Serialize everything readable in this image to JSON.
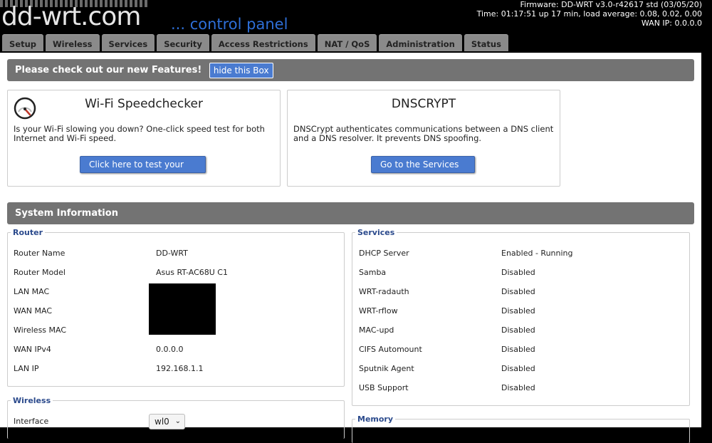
{
  "header": {
    "logo_text": "dd-wrt.com",
    "logo_sub": "... control panel",
    "firmware": "Firmware: DD-WRT v3.0-r42617 std (03/05/20)",
    "time": "Time: 01:17:51 up 17 min, load average: 0.08, 0.02, 0.00",
    "wan_ip": "WAN IP: 0.0.0.0"
  },
  "tabs": [
    {
      "label": "Setup"
    },
    {
      "label": "Wireless"
    },
    {
      "label": "Services"
    },
    {
      "label": "Security"
    },
    {
      "label": "Access Restrictions"
    },
    {
      "label": "NAT / QoS"
    },
    {
      "label": "Administration"
    },
    {
      "label": "Status"
    }
  ],
  "features": {
    "title": "Please check out our new Features!",
    "hide_label": "hide this Box"
  },
  "promos": {
    "wifi": {
      "title": "Wi-Fi Speedchecker",
      "desc": "Is your Wi-Fi slowing you down? One-click speed test for both Internet and Wi-Fi speed.",
      "button": "Click here to test your speed",
      "icon": "speedometer-icon"
    },
    "dns": {
      "title": "DNSCRYPT",
      "desc": "DNSCrypt authenticates communications between a DNS client and a DNS resolver. It prevents DNS spoofing.",
      "button": "Go to the Services Tab"
    }
  },
  "sysinfo": {
    "title": "System Information",
    "router": {
      "legend": "Router",
      "rows": [
        {
          "label": "Router Name",
          "value": "DD-WRT"
        },
        {
          "label": "Router Model",
          "value": "Asus RT-AC68U C1"
        },
        {
          "label": "LAN MAC",
          "value": ""
        },
        {
          "label": "WAN MAC",
          "value": ""
        },
        {
          "label": "Wireless MAC",
          "value": ""
        },
        {
          "label": "WAN IPv4",
          "value": "0.0.0.0"
        },
        {
          "label": "LAN IP",
          "value": "192.168.1.1"
        }
      ]
    },
    "services": {
      "legend": "Services",
      "rows": [
        {
          "label": "DHCP Server",
          "value": "Enabled - Running"
        },
        {
          "label": "Samba",
          "value": "Disabled"
        },
        {
          "label": "WRT-radauth",
          "value": "Disabled"
        },
        {
          "label": "WRT-rflow",
          "value": "Disabled"
        },
        {
          "label": "MAC-upd",
          "value": "Disabled"
        },
        {
          "label": "CIFS Automount",
          "value": "Disabled"
        },
        {
          "label": "Sputnik Agent",
          "value": "Disabled"
        },
        {
          "label": "USB Support",
          "value": "Disabled"
        }
      ]
    },
    "wireless": {
      "legend": "Wireless",
      "interface_label": "Interface",
      "interface_value": "wl0"
    },
    "memory": {
      "legend": "Memory"
    }
  },
  "colors": {
    "accent_blue": "#4a7bd0",
    "section_gray": "#737373",
    "legend_blue": "#2b4a8c"
  }
}
